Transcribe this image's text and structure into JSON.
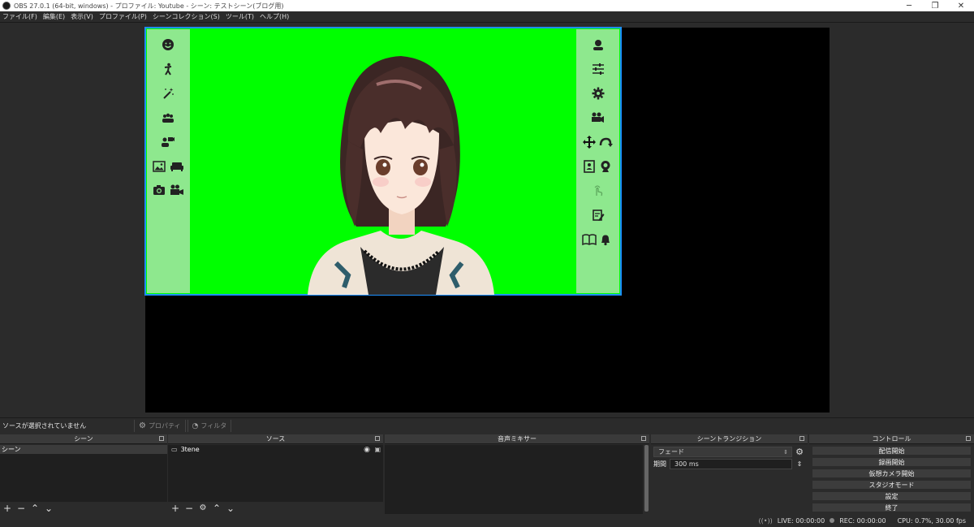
{
  "window": {
    "title": "OBS 27.0.1 (64-bit, windows) - プロファイル: Youtube - シーン: テストシーン(ブログ用)",
    "minimize": "─",
    "restore": "❐",
    "close": "✕"
  },
  "menu": [
    "ファイル(F)",
    "編集(E)",
    "表示(V)",
    "プロファイル(P)",
    "シーンコレクション(S)",
    "ツール(T)",
    "ヘルプ(H)"
  ],
  "source_toolbar": {
    "no_source": "ソースが選択されていません",
    "properties": "プロパティ",
    "filters": "フィルタ"
  },
  "docks": {
    "scenes": {
      "title": "シーン",
      "items": [
        "シーン"
      ]
    },
    "sources": {
      "title": "ソース",
      "items": [
        {
          "name": "3tene"
        }
      ]
    },
    "mixer": {
      "title": "音声ミキサー"
    },
    "transitions": {
      "title": "シーントランジション",
      "selected": "フェード",
      "duration_label": "期間",
      "duration_value": "300 ms"
    },
    "controls": {
      "title": "コントロール",
      "buttons": [
        "配信開始",
        "録画開始",
        "仮想カメラ開始",
        "スタジオモード",
        "設定",
        "終了"
      ]
    }
  },
  "status": {
    "live": "LIVE: 00:00:00",
    "rec": "REC: 00:00:00",
    "cpu": "CPU: 0.7%, 30.00 fps"
  },
  "colors": {
    "chroma": "#00ff00",
    "panel": "#8ee88e",
    "selection": "#1e90ff"
  }
}
